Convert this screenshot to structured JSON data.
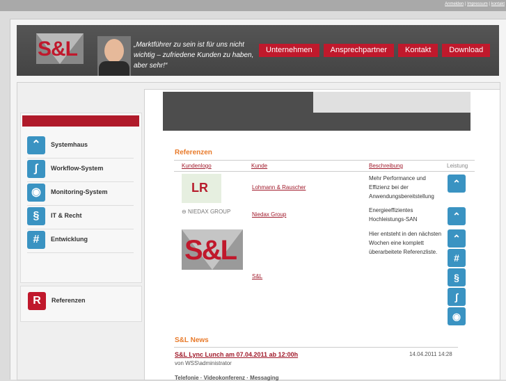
{
  "toplinks": [
    "Anmelden",
    "Impressum",
    "kontakt"
  ],
  "header": {
    "logo_text": "S&L",
    "quote": "„Marktführer zu sein ist für uns nicht wichtig – zufriedene Kunden zu haben, aber sehr!“",
    "nav": [
      "Unternehmen",
      "Ansprechpartner",
      "Kontakt",
      "Download"
    ]
  },
  "sidebar": {
    "items": [
      {
        "label": "Systemhaus",
        "icon": "up-chevrons-icon"
      },
      {
        "label": "Workflow-System",
        "icon": "workflow-icon"
      },
      {
        "label": "Monitoring-System",
        "icon": "eye-icon"
      },
      {
        "label": "IT & Recht",
        "icon": "paragraph-icon"
      },
      {
        "label": "Entwicklung",
        "icon": "hash-icon"
      }
    ],
    "referenzen": "Referenzen"
  },
  "referenzen": {
    "title": "Referenzen",
    "columns": [
      "Kundenlogo",
      "Kunde",
      "Beschreibung",
      "Leistung"
    ],
    "rows": [
      {
        "kunde": "Lohmann & Rauscher",
        "beschreibung": "Mehr Performance und Effizienz bei der Anwendungsbereitstellung",
        "logo_text": "LR"
      },
      {
        "kunde": "Niedax Group",
        "beschreibung": "Energieeffizientes Hochleistungs-SAN",
        "logo_text": "NIEDAX GROUP"
      },
      {
        "kunde": "S&L",
        "beschreibung": "Hier entsteht in den nächsten Wochen eine komplett überarbeitete Referenzliste.",
        "logo_text": "S&L"
      }
    ]
  },
  "news": {
    "title": "S&L News",
    "item_title": "S&L Lync Lunch am 07.04.2011 ab 12:00h",
    "date": "14.04.2011 14:28",
    "author": "von WSS\\administrator",
    "teaser": "Telefonie · Videokonferenz · Messaging"
  },
  "colors": {
    "accent": "#c0192c",
    "icon_blue": "#3a93c2",
    "heading_orange": "#e87a2a"
  }
}
